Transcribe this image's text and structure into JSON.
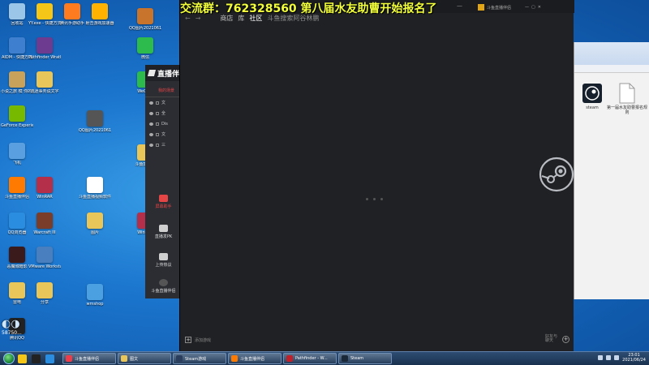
{
  "overlay": {
    "banner": "交流群：762328560   第八届水友助曹开始报名了"
  },
  "steam": {
    "nav": {
      "back": "←",
      "forward": "→",
      "store": "商店",
      "library_icon": "库",
      "community": "社区",
      "username": "斗鱼搜索阿谷林鹏"
    },
    "bottom_left": {
      "add_game": "添加游戏"
    },
    "bottom_right": {
      "friends": "好友与聊天",
      "plus": "+"
    },
    "logo_icon": "steam-logo-icon"
  },
  "app_titlebar": {
    "title": "斗鱼直播伴侣"
  },
  "window_controls": {
    "min": "—",
    "max": "▢",
    "close": "✕"
  },
  "stream_panel": {
    "logo": "直播伴",
    "tab": "我的场景",
    "scenes": [
      "文",
      "全",
      "Dis",
      "文",
      "三"
    ],
    "buttons": [
      {
        "label": "屏幕助手"
      },
      {
        "label": "直播发PK"
      },
      {
        "label": "上传热议"
      },
      {
        "label": "斗鱼直播伴侣"
      }
    ]
  },
  "desktop_icons": [
    {
      "label": "回收站",
      "color": "#9cc6e8"
    },
    {
      "label": "YY.exe - 快捷方式",
      "color": "#f5c518"
    },
    {
      "label": "腾讯手游助手",
      "color": "#ff7b1f"
    },
    {
      "label": "射击游戏加速器",
      "color": "#ffb300"
    },
    {
      "label": "QQ图片20210611...",
      "color": "#c9742c"
    },
    {
      "label": "AIDM - 快捷方式",
      "color": "#3f7fd0"
    },
    {
      "label": "Pathfinder Wrath o...",
      "color": "#6d3b8f"
    },
    {
      "label": "微信",
      "color": "#2dbb4e"
    },
    {
      "label": "小说之旅 模 你的狂...",
      "color": "#c8a25a"
    },
    {
      "label": "沉迷事务说文字",
      "color": "#e8c65a"
    },
    {
      "label": "WeChat",
      "color": "#2dbb4e"
    },
    {
      "label": "GeForce Experience",
      "color": "#76b900"
    },
    {
      "label": "QQ图片20210611...",
      "color": "#555"
    },
    {
      "label": "飞机",
      "color": "#5aa0e0"
    },
    {
      "label": "斗鱼直播伴侣",
      "color": "#ff7a00"
    },
    {
      "label": "WinRAR",
      "color": "#b4304a"
    },
    {
      "label": "斗鱼直播视频软件",
      "color": "#ffffff"
    },
    {
      "label": "斗鱼加速器",
      "color": "#e8c65a"
    },
    {
      "label": "QQ浏览器",
      "color": "#2a8de0"
    },
    {
      "label": "Warcraft III",
      "color": "#7a3d2a"
    },
    {
      "label": "WinRAR",
      "color": "#b4304a"
    },
    {
      "label": "图片",
      "color": "#e8c65a"
    },
    {
      "label": "VMware Workstation",
      "color": "#4a7fbf"
    },
    {
      "label": "恶魔城暗影",
      "color": "#3a1a1a"
    },
    {
      "label": "雷电",
      "color": "#e8c65a"
    },
    {
      "label": "分享",
      "color": "#e8c65a"
    },
    {
      "label": "wmshop",
      "color": "#4aa0e0"
    },
    {
      "label": "腾讯QQ",
      "color": "#222"
    }
  ],
  "explorer": {
    "items": [
      {
        "label": "steam"
      },
      {
        "label": "第一届水友助曹报名规则"
      }
    ]
  },
  "watermark": {
    "text": "58750..."
  },
  "taskbar": {
    "buttons": [
      {
        "label": "斗鱼直播伴侣",
        "color": "#f03c4a"
      },
      {
        "label": "图文",
        "color": "#e8c65a"
      },
      {
        "label": "Steam游戏",
        "color": "#2a3d5c"
      },
      {
        "label": "斗鱼直播伴侣",
        "color": "#ff7a00"
      },
      {
        "label": "Pathfinder - W...",
        "color": "#c0202a"
      },
      {
        "label": "Steam",
        "color": "#1b2838"
      }
    ],
    "clock_time": "23:01",
    "clock_date": "2021/06/24"
  }
}
